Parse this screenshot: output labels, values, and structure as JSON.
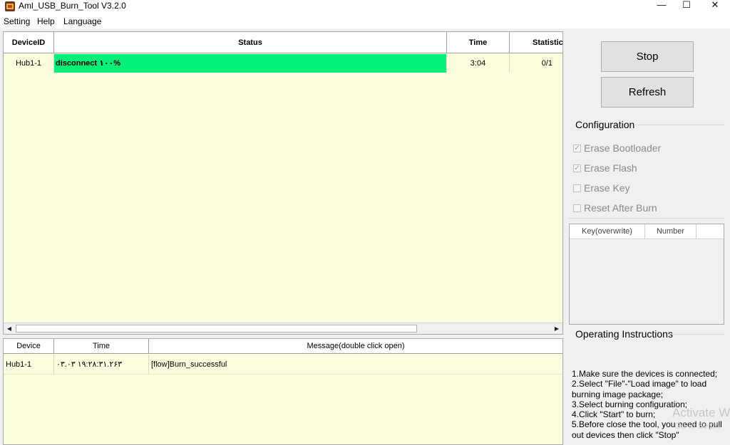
{
  "window": {
    "title": "Aml_USB_Burn_Tool V3.2.0"
  },
  "window_controls": {
    "minimize": "—",
    "maximize": "☐",
    "close": "✕"
  },
  "menu": {
    "items": [
      "Setting",
      "Help",
      "Language"
    ]
  },
  "device_table": {
    "columns": [
      "DeviceID",
      "Status",
      "Time",
      "Statistic"
    ],
    "rows": [
      {
        "device_id": "Hub1-1",
        "status": "disconnect ۱۰۰%",
        "time": "3:04",
        "statistic": "0/1"
      }
    ]
  },
  "log_table": {
    "columns": [
      "Device",
      "Time",
      "Message(double click open)"
    ],
    "rows": [
      {
        "device": "Hub1-1",
        "time": "۰۳.۰۳ ۱۹:۲۸:۳۱.۲۶۳",
        "message": "[flow]Burn_successful"
      }
    ]
  },
  "buttons": {
    "stop": "Stop",
    "refresh": "Refresh"
  },
  "configuration": {
    "title": "Configuration",
    "options": [
      {
        "label": "Erase Bootloader",
        "checked": true
      },
      {
        "label": "Erase Flash",
        "checked": true
      },
      {
        "label": "Erase Key",
        "checked": false
      },
      {
        "label": "Reset After Burn",
        "checked": false
      }
    ]
  },
  "key_table": {
    "columns": [
      "Key(overwrite)",
      "Number"
    ]
  },
  "instructions": {
    "title": "Operating Instructions",
    "lines": [
      "1.Make sure the devices is connected;",
      "2.Select \"File\"-\"Load image\" to load burning image package;",
      "3.Select burning configuration;",
      "4.Click \"Start\" to burn;",
      "5.Before close the tool, you need to pull out devices then click \"Stop\""
    ]
  },
  "watermark": {
    "title": "Activate W",
    "subtitle": "Go to Settin"
  },
  "colors": {
    "status_success": "#00f078",
    "table_background": "#fdfde0",
    "window_background": "#f0f0f0"
  }
}
